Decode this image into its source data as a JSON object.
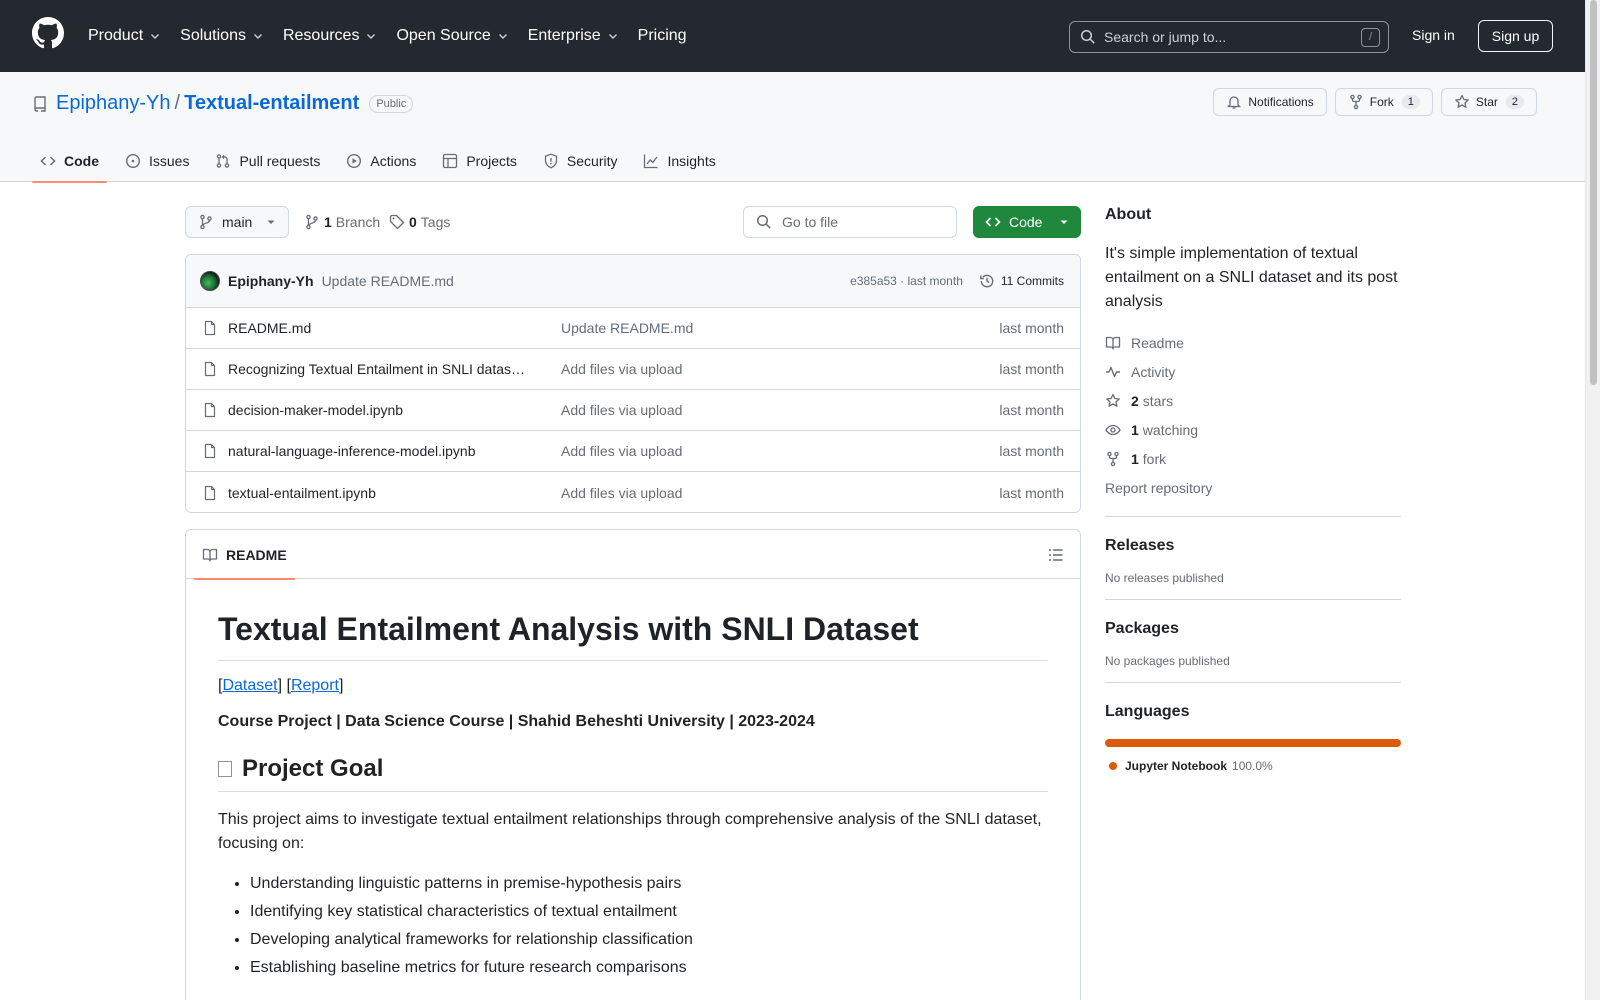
{
  "header": {
    "nav": [
      {
        "label": "Product",
        "dropdown": true
      },
      {
        "label": "Solutions",
        "dropdown": true
      },
      {
        "label": "Resources",
        "dropdown": true
      },
      {
        "label": "Open Source",
        "dropdown": true
      },
      {
        "label": "Enterprise",
        "dropdown": true
      },
      {
        "label": "Pricing",
        "dropdown": false
      }
    ],
    "search_placeholder": "Search or jump to...",
    "search_shortcut": "/",
    "sign_in": "Sign in",
    "sign_up": "Sign up"
  },
  "repo": {
    "owner": "Epiphany-Yh",
    "separator": "/",
    "name": "Textual-entailment",
    "visibility": "Public",
    "actions": {
      "notifications": "Notifications",
      "fork": "Fork",
      "fork_count": "1",
      "star": "Star",
      "star_count": "2"
    },
    "tabs": [
      {
        "label": "Code",
        "icon": "code-icon",
        "active": true
      },
      {
        "label": "Issues",
        "icon": "issue-icon",
        "active": false
      },
      {
        "label": "Pull requests",
        "icon": "pull-request-icon",
        "active": false
      },
      {
        "label": "Actions",
        "icon": "play-icon",
        "active": false
      },
      {
        "label": "Projects",
        "icon": "table-icon",
        "active": false
      },
      {
        "label": "Security",
        "icon": "shield-icon",
        "active": false
      },
      {
        "label": "Insights",
        "icon": "graph-icon",
        "active": false
      }
    ]
  },
  "toolbar": {
    "branch": "main",
    "branch_count": "1",
    "branch_label": "Branch",
    "tag_count": "0",
    "tag_label": "Tags",
    "goto_placeholder": "Go to file",
    "code_button": "Code"
  },
  "commit": {
    "author": "Epiphany-Yh",
    "message": "Update README.md",
    "meta": "e385a53 · last month",
    "commits": "11 Commits"
  },
  "files": [
    {
      "name": "README.md",
      "message": "Update README.md",
      "date": "last month"
    },
    {
      "name": "Recognizing Textual Entailment in SNLI datas…",
      "message": "Add files via upload",
      "date": "last month"
    },
    {
      "name": "decision-maker-model.ipynb",
      "message": "Add files via upload",
      "date": "last month"
    },
    {
      "name": "natural-language-inference-model.ipynb",
      "message": "Add files via upload",
      "date": "last month"
    },
    {
      "name": "textual-entailment.ipynb",
      "message": "Add files via upload",
      "date": "last month"
    }
  ],
  "readme": {
    "tab": "README",
    "title": "Textual Entailment Analysis with SNLI Dataset",
    "link_open": "[",
    "link_mid": "] [",
    "link_close": "]",
    "link_dataset": "Dataset",
    "link_report": "Report",
    "course": "Course Project | Data Science Course | Shahid Beheshti University | 2023-2024",
    "goal_heading": "Project Goal",
    "goal_text": "This project aims to investigate textual entailment relationships through comprehensive analysis of the SNLI dataset, focusing on:",
    "bullets": [
      "Understanding linguistic patterns in premise-hypothesis pairs",
      "Identifying key statistical characteristics of textual entailment",
      "Developing analytical frameworks for relationship classification",
      "Establishing baseline metrics for future research comparisons"
    ]
  },
  "sidebar": {
    "about_title": "About",
    "description": "It's simple implementation of textual entailment on a SNLI dataset and its post analysis",
    "readme": "Readme",
    "activity": "Activity",
    "stars_count": "2",
    "stars_label": "stars",
    "watching_count": "1",
    "watching_label": "watching",
    "fork_count": "1",
    "fork_label": "fork",
    "report": "Report repository",
    "releases_title": "Releases",
    "releases_empty": "No releases published",
    "packages_title": "Packages",
    "packages_empty": "No packages published",
    "languages_title": "Languages",
    "languages": [
      {
        "name": "Jupyter Notebook",
        "percent": "100.0%",
        "color": "#DA5B0B"
      }
    ]
  },
  "colors": {
    "header_bg": "#24292f",
    "link": "#0969da",
    "primary_button": "#1f883d",
    "tab_underline": "#fd8c73",
    "jupyter": "#DA5B0B"
  }
}
